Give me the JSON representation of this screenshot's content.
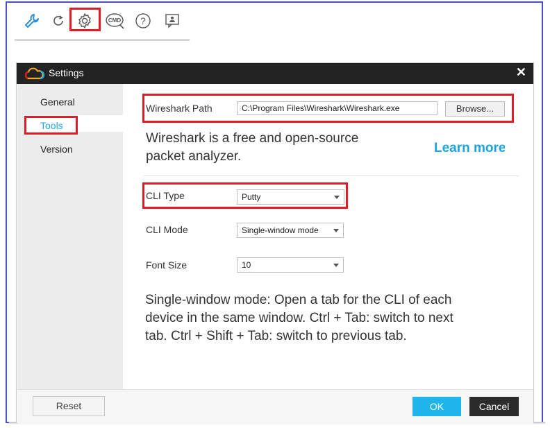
{
  "toolbar": {
    "icons": [
      "wrench-icon",
      "refresh-icon",
      "settings-gear-icon",
      "cmd-icon",
      "help-icon",
      "feedback-icon"
    ],
    "cmd_label": "CMD",
    "help_glyph": "?"
  },
  "dialog": {
    "title": "Settings",
    "close_glyph": "✕"
  },
  "sidebar": {
    "items": [
      {
        "label": "General"
      },
      {
        "label": "Tools"
      },
      {
        "label": "Version"
      }
    ]
  },
  "tools": {
    "wireshark_label": "Wireshark Path",
    "wireshark_path": "C:\\Program Files\\Wireshark\\Wireshark.exe",
    "browse_label": "Browse...",
    "wireshark_desc_line1": "Wireshark is a free and open-source",
    "wireshark_desc_line2": "packet analyzer.",
    "learn_more": "Learn more",
    "cli_type_label": "CLI Type",
    "cli_type_value": "Putty",
    "cli_mode_label": "CLI Mode",
    "cli_mode_value": "Single-window mode",
    "font_size_label": "Font Size",
    "font_size_value": "10",
    "mode_desc_line1": "Single-window mode: Open a tab for the CLI of each",
    "mode_desc_line2": "device in the same window. Ctrl + Tab: switch to next",
    "mode_desc_line3": "tab. Ctrl + Shift + Tab: switch to previous tab."
  },
  "footer": {
    "reset_label": "Reset",
    "ok_label": "OK",
    "cancel_label": "Cancel"
  },
  "colors": {
    "highlight": "#e01b24",
    "accent": "#1fb4ea",
    "icon_blue": "#2b8fd6",
    "frame": "#4a4fc8"
  }
}
